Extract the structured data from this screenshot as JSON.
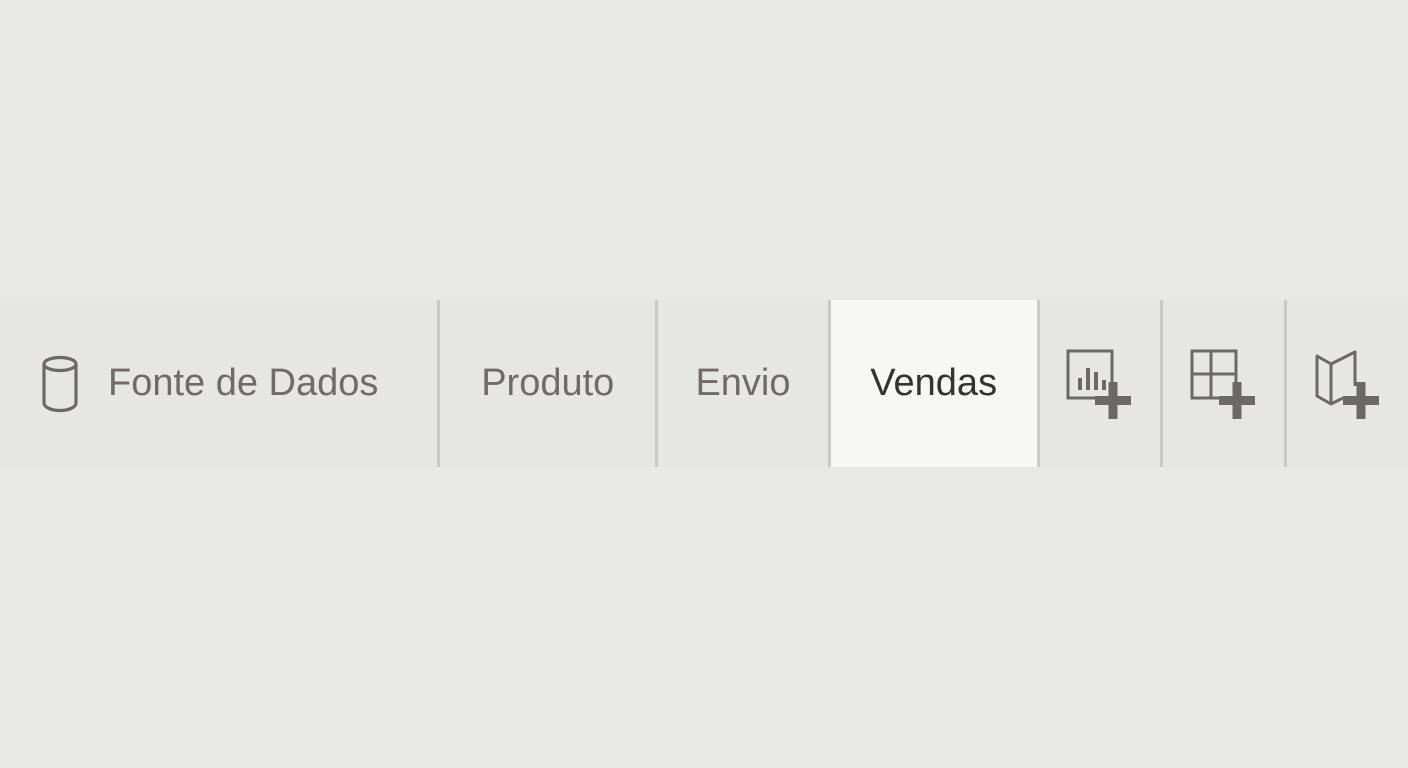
{
  "tabs": {
    "data_source": {
      "label": "Fonte de Dados",
      "icon": "database-icon"
    },
    "produto": {
      "label": "Produto"
    },
    "envio": {
      "label": "Envio"
    },
    "vendas": {
      "label": "Vendas",
      "selected": true
    }
  },
  "actions": [
    {
      "icon": "new-worksheet-icon"
    },
    {
      "icon": "new-dashboard-icon"
    },
    {
      "icon": "new-story-icon"
    }
  ],
  "colors": {
    "background": "#e8e8e7",
    "active_tab": "#f7f7f6",
    "text": "#6e6b68",
    "active_text": "#333333",
    "icon": "#6b6966"
  }
}
